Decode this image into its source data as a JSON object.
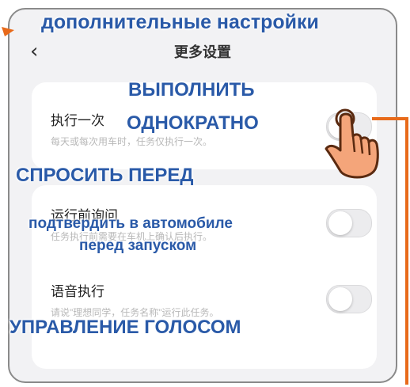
{
  "header": {
    "back_glyph": "‹",
    "title_cn": "更多设置",
    "title_annotation": "дополнительные настройки"
  },
  "settings": [
    {
      "title": "执行一次",
      "description": "每天或每次用车时，任务仅执行一次。",
      "enabled": false,
      "annotation": [
        "ВЫПОЛНИТЬ",
        "ОДНОКРАТНО"
      ]
    },
    {
      "title": "运行前询问",
      "description": "任务执行前需要在车机上确认后执行。",
      "enabled": false,
      "annotation_heading": "СПРОСИТЬ ПЕРЕД",
      "annotation": [
        "подтвердить в автомобиле",
        "перед запуском"
      ]
    },
    {
      "title": "语音执行",
      "description": "请说\"理想同学，任务名称\"运行此任务。",
      "enabled": false,
      "annotation": [
        "УПРАВЛЕНИЕ ГОЛОСОМ"
      ]
    }
  ],
  "icons": {
    "tap_hand": "hand-tap-icon"
  },
  "colors": {
    "annotation": "#2a5aa8",
    "arrow": "#e86a1a",
    "hand_fill": "#f4a57a"
  }
}
